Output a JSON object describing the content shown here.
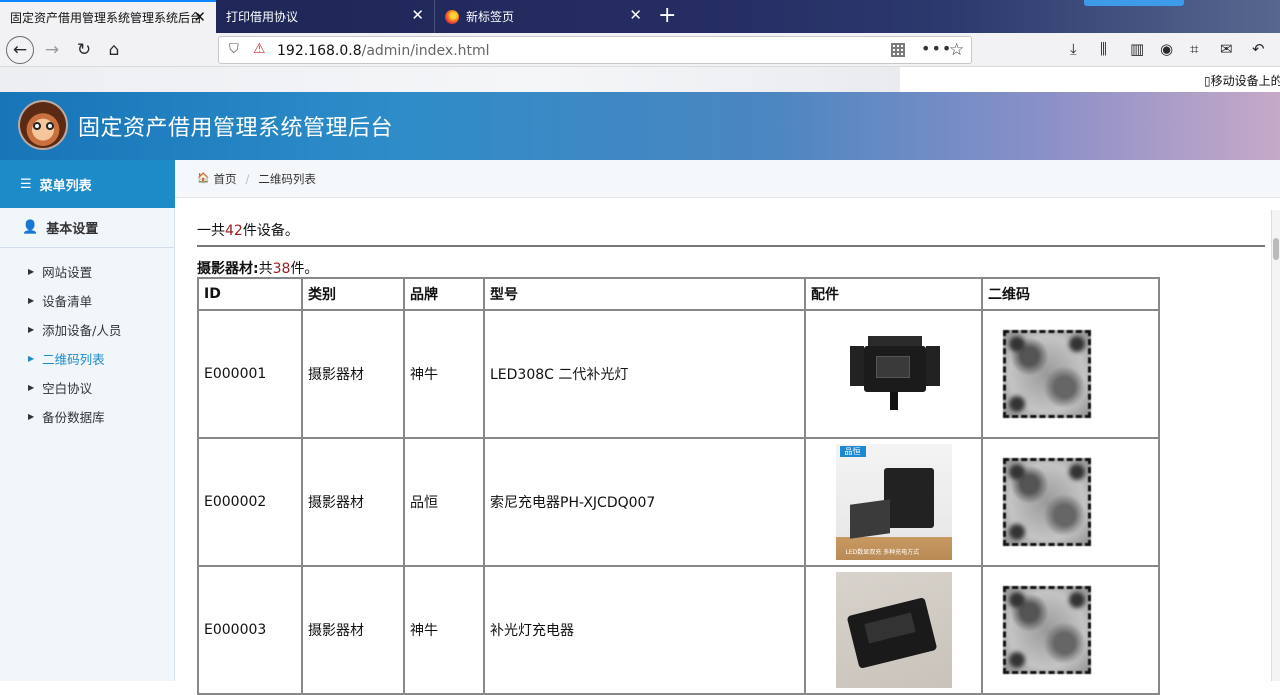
{
  "browser": {
    "tabs": [
      {
        "title": "固定资产借用管理系统管理系统后台",
        "close": "✕"
      },
      {
        "title": "打印借用协议",
        "close": "✕"
      },
      {
        "title": "新标签页",
        "close": "✕"
      }
    ],
    "new_tab": "+",
    "url_host": "192.168.0.8",
    "url_path": "/admin/index.html",
    "mobile_link": "▯移动设备上的"
  },
  "app": {
    "title": "固定资产借用管理系统管理后台"
  },
  "sidebar": {
    "menu_header": "菜单列表",
    "section_title": "基本设置",
    "items": [
      {
        "label": "网站设置"
      },
      {
        "label": "设备清单"
      },
      {
        "label": "添加设备/人员"
      },
      {
        "label": "二维码列表"
      },
      {
        "label": "空白协议"
      },
      {
        "label": "备份数据库"
      }
    ],
    "active_index": 3
  },
  "breadcrumb": {
    "home": "首页",
    "current": "二维码列表"
  },
  "summary": {
    "total_prefix": "一共",
    "total_count": "42",
    "total_suffix": "件设备。",
    "category_name": "摄影器材:",
    "category_prefix": "共",
    "category_count": "38",
    "category_suffix": "件。"
  },
  "table": {
    "headers": [
      "ID",
      "类别",
      "品牌",
      "型号",
      "配件",
      "二维码"
    ],
    "rows": [
      {
        "id": "E000001",
        "category": "摄影器材",
        "brand": "神牛",
        "model": "LED308C 二代补光灯",
        "thumb": "light"
      },
      {
        "id": "E000002",
        "category": "摄影器材",
        "brand": "品恒",
        "model": "索尼充电器PH-XJCDQ007",
        "thumb": "charger1",
        "thumb_brand": "品恒",
        "thumb_caption": "LED数显双充   多种充电方式"
      },
      {
        "id": "E000003",
        "category": "摄影器材",
        "brand": "神牛",
        "model": "补光灯充电器",
        "thumb": "charger2"
      }
    ]
  },
  "colors": {
    "accent": "#1e8bc9",
    "count_red": "#9b1c1c"
  }
}
